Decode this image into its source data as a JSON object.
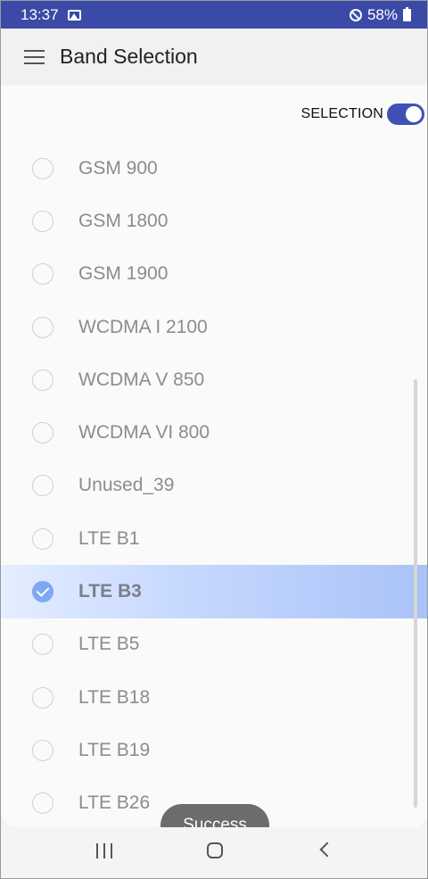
{
  "status_bar": {
    "time": "13:37",
    "battery_percent": "58%",
    "icons": [
      "image-icon",
      "do-not-disturb-icon",
      "battery-icon"
    ]
  },
  "app_bar": {
    "title": "Band Selection",
    "menu_icon": "hamburger-menu-icon"
  },
  "selection_toggle": {
    "label": "SELECTION",
    "enabled": true
  },
  "bands": [
    {
      "label": "GSM 900",
      "selected": false
    },
    {
      "label": "GSM 1800",
      "selected": false
    },
    {
      "label": "GSM 1900",
      "selected": false
    },
    {
      "label": "WCDMA I 2100",
      "selected": false
    },
    {
      "label": "WCDMA V 850",
      "selected": false
    },
    {
      "label": "WCDMA VI 800",
      "selected": false
    },
    {
      "label": "Unused_39",
      "selected": false
    },
    {
      "label": "LTE B1",
      "selected": false
    },
    {
      "label": "LTE B3",
      "selected": true
    },
    {
      "label": "LTE B5",
      "selected": false
    },
    {
      "label": "LTE B18",
      "selected": false
    },
    {
      "label": "LTE B19",
      "selected": false
    },
    {
      "label": "LTE B26",
      "selected": false
    }
  ],
  "toast": {
    "message": "Success"
  },
  "colors": {
    "status_bar": "#3b4aa6",
    "accent": "#3f51b5",
    "selected_check": "#7fa8f2"
  }
}
